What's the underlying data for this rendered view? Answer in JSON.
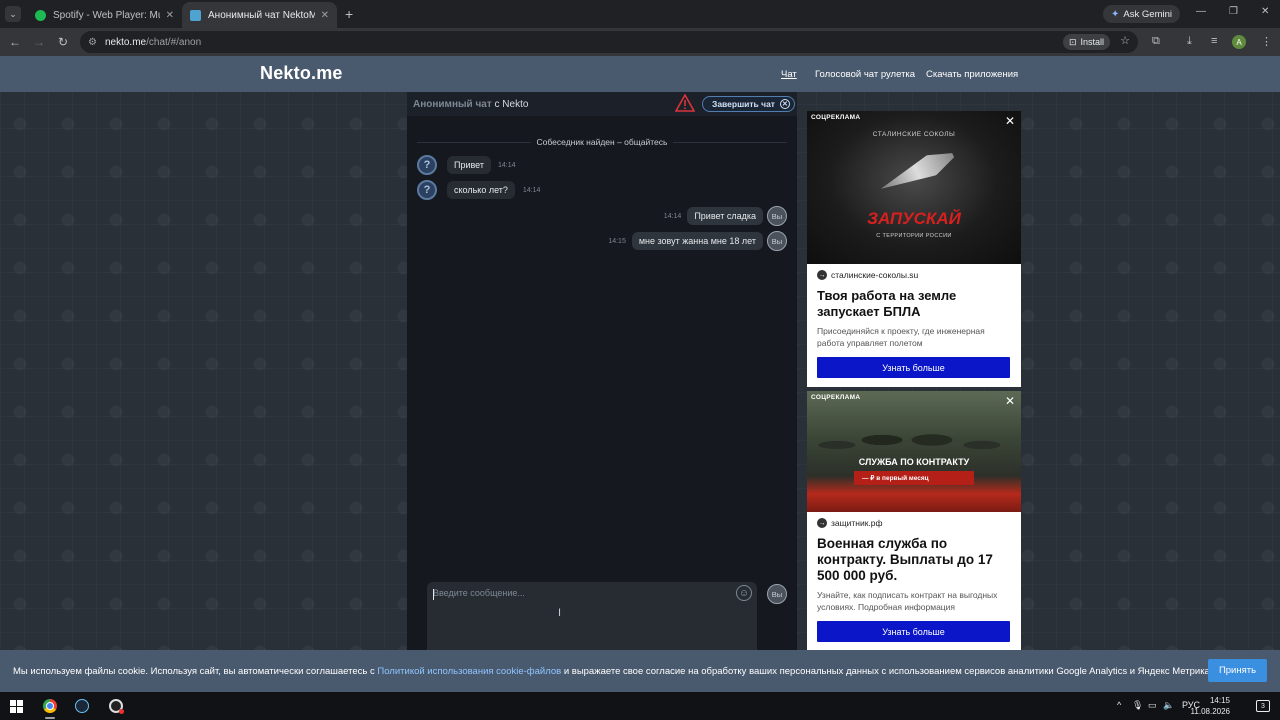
{
  "browser": {
    "tabs": [
      {
        "title": "Spotify - Web Player: Music for",
        "icon": "spotify-icon",
        "active": false
      },
      {
        "title": "Анонимный чат NektoMe",
        "icon": "nekto-icon",
        "active": true
      }
    ],
    "ask_gemini": "Ask Gemini",
    "url_host": "nekto.me",
    "url_path": "/chat/#/anon",
    "install_label": "Install",
    "profile_initial": "A"
  },
  "site": {
    "logo": "Nekto.me",
    "nav": [
      "Чат",
      "Голосовой чат рулетка",
      "Скачать приложения"
    ]
  },
  "chat": {
    "header_muted": "Анонимный чат",
    "header_rest": " с Nekto",
    "end_chat_label": "Завершить чат",
    "system_message": "Собеседник найден – общайтесь",
    "messages": [
      {
        "from": "stranger",
        "text": "Привет",
        "time": "14:14"
      },
      {
        "from": "stranger",
        "text": "сколько лет?",
        "time": "14:14"
      },
      {
        "from": "me",
        "text": "Привет сладка",
        "time": "14:14"
      },
      {
        "from": "me",
        "text": "мне зовут жанна мне 18 лет",
        "time": "14:15"
      }
    ],
    "stranger_avatar": "?",
    "me_avatar": "Вы",
    "input_placeholder": "Введите сообщение..."
  },
  "ads": [
    {
      "tag": "СОЦРЕКЛАМА",
      "image_subhead": "СТАЛИНСКИЕ СОКОЛЫ",
      "image_headline": "ЗАПУСКАЙ",
      "image_tagline": "С ТЕРРИТОРИИ РОССИИ",
      "domain": "сталинские-соколы.su",
      "title": "Твоя работа на земле запускает БПЛА",
      "text": "Присоединяйся к проекту, где инженерная работа управляет полетом",
      "cta": "Узнать больше"
    },
    {
      "tag": "СОЦРЕКЛАМА",
      "image_headline": "СЛУЖБА ПО КОНТРАКТУ",
      "image_strip": "— ₽ в первый месяц",
      "domain": "защитник.рф",
      "title": "Военная служба по контракту. Выплаты до 17 500 000 руб.",
      "text": "Узнайте, как подписать контракт на выгодных условиях. Подробная информация",
      "cta": "Узнать больше"
    }
  ],
  "cookie": {
    "text_before": "Мы используем файлы cookie. Используя сайт, вы автоматически соглашаетесь с ",
    "link": "Политикой использования cookie-файлов",
    "text_after": " и выражаете свое согласие на обработку ваших персональных данных с использованием сервисов аналитики Google Analytics и Яндекс Метрика.",
    "accept": "Принять"
  },
  "taskbar": {
    "lang": "РУС",
    "time": "14:15",
    "date": "11.08.2026",
    "notifications": "3"
  }
}
